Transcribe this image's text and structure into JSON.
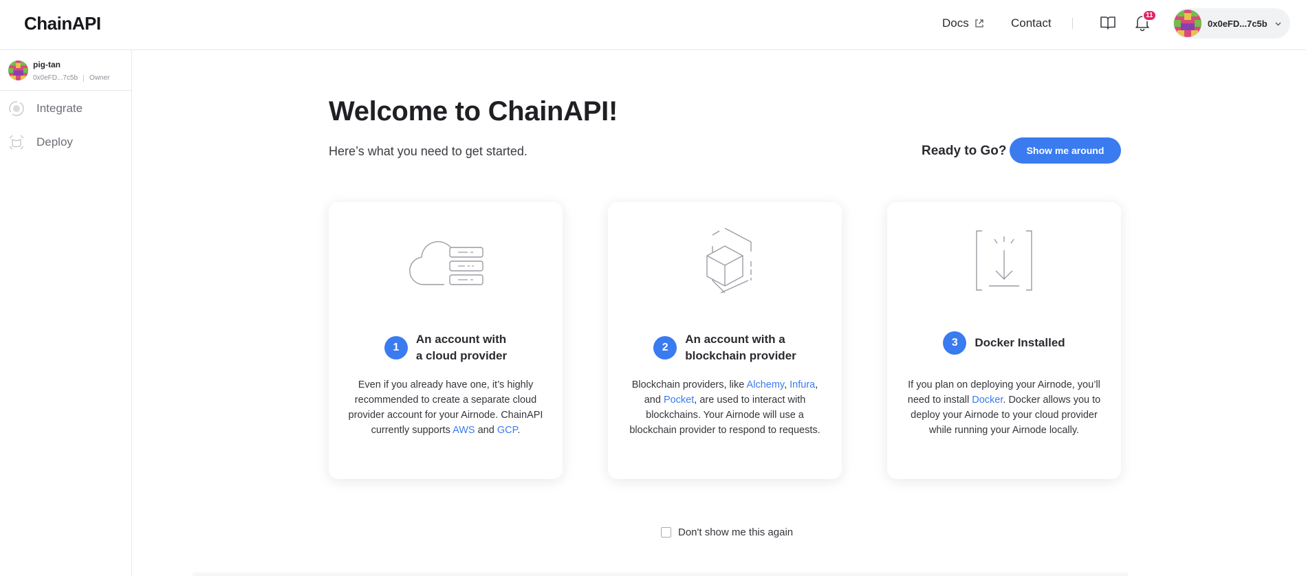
{
  "brand": {
    "logo": "ChainAPI",
    "accent": "#3a7bf0",
    "badge_color": "#e4245f"
  },
  "header": {
    "nav": {
      "docs_label": "Docs",
      "contact_label": "Contact"
    },
    "notifications": {
      "count": "11"
    },
    "account": {
      "address": "0x0eFD...7c5b"
    }
  },
  "sidebar": {
    "org": {
      "name": "pig-tan",
      "address": "0x0eFD...7c5b",
      "role": "Owner"
    },
    "items": [
      {
        "label": "Integrate",
        "icon": "integrate-icon"
      },
      {
        "label": "Deploy",
        "icon": "deploy-icon"
      }
    ]
  },
  "main": {
    "title": "Welcome to ChainAPI!",
    "subtitle": "Here’s what you need to get started.",
    "ready_label": "Ready to Go?",
    "show_button": "Show me around",
    "cards": [
      {
        "number": "1",
        "title_line1": "An account with",
        "title_line2": "a cloud provider",
        "icon": "cloud-server-icon",
        "text_a": "Even if you already have one, it’s highly recommended to create a separate cloud provider account for your Airnode. ChainAPI currently supports ",
        "link_aws": "AWS",
        "text_b": " and ",
        "link_gcp": "GCP",
        "text_c": "."
      },
      {
        "number": "2",
        "title_line1": "An account with a",
        "title_line2": "blockchain provider",
        "icon": "blockchain-cube-icon",
        "text_a": "Blockchain providers, like ",
        "link_alchemy": "Alchemy",
        "text_b": ", ",
        "link_infura": "Infura",
        "text_c": ", and ",
        "link_pocket": "Pocket",
        "text_d": ", are used to interact with blockchains. Your Airnode will use a blockchain provider to respond to requests."
      },
      {
        "number": "3",
        "title_line1": "Docker Installed",
        "icon": "download-box-icon",
        "text_a": "If you plan on deploying your Airnode, you’ll need to install ",
        "link_docker": "Docker",
        "text_b": ". Docker allows you to deploy your Airnode to your cloud provider while running your Airnode locally."
      }
    ],
    "dont_show_label": "Don't show me this again"
  }
}
